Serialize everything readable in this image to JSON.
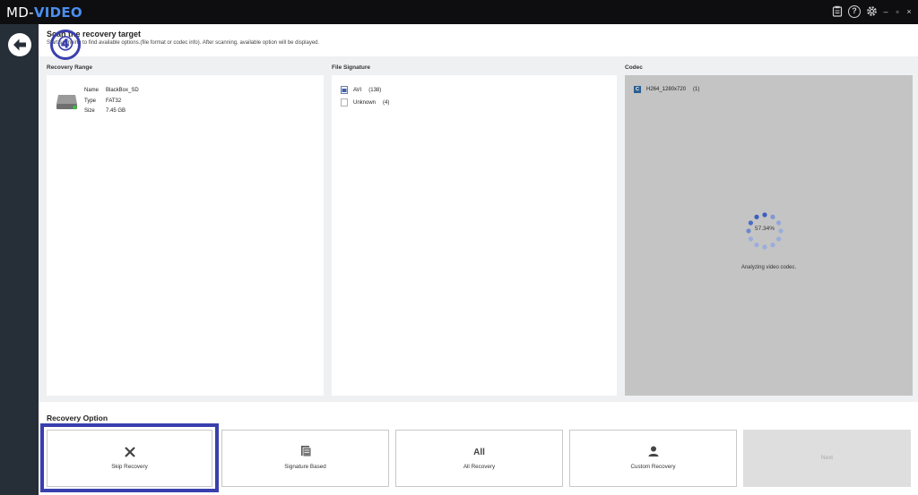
{
  "app": {
    "logo_prefix": "MD-",
    "logo_suffix": "VIDEO",
    "icons": [
      "clipboard-icon",
      "help-icon",
      "settings-icon",
      "minimize-icon",
      "restore-icon",
      "close-icon"
    ],
    "help_glyph": "?",
    "minimize_glyph": "–",
    "restore_glyph": "▫",
    "close_glyph": "×"
  },
  "scan": {
    "title": "Scan the recovery target",
    "description": "Start scanning to find available options.(file format or codec info). After scanning, available option will be displayed."
  },
  "columns": {
    "recovery_range": "Recovery Range",
    "file_signature": "File Signature",
    "codec": "Codec"
  },
  "drive": {
    "name_key": "Name",
    "name": "BlackBox_SD",
    "type_key": "Type",
    "type": "FAT32",
    "size_key": "Size",
    "size": "7.45 GB"
  },
  "signatures": [
    {
      "name": "AVI",
      "count": "(138)"
    },
    {
      "name": "Unknown",
      "count": "(4)"
    }
  ],
  "codecs": [
    {
      "badge": "C",
      "name": "H264_1280x720",
      "count": "(1)"
    }
  ],
  "progress": {
    "percent": 57.34,
    "percent_label": "57.34%",
    "status": "Analyzing video codec."
  },
  "recovery_option": {
    "title": "Recovery Option",
    "skip": "Skip Recovery",
    "signature": "Signature Based",
    "all_icon_text": "All",
    "all": "All Recovery",
    "custom": "Custom Recovery",
    "next": "Next"
  },
  "annotation": {
    "step": "④"
  },
  "colors": {
    "titlebar": "#0e0e10",
    "sidebar": "#262e38",
    "accent_blue": "#4a8ef0",
    "highlight": "#3a3fae",
    "codec_panel": "#c4c4c4"
  }
}
